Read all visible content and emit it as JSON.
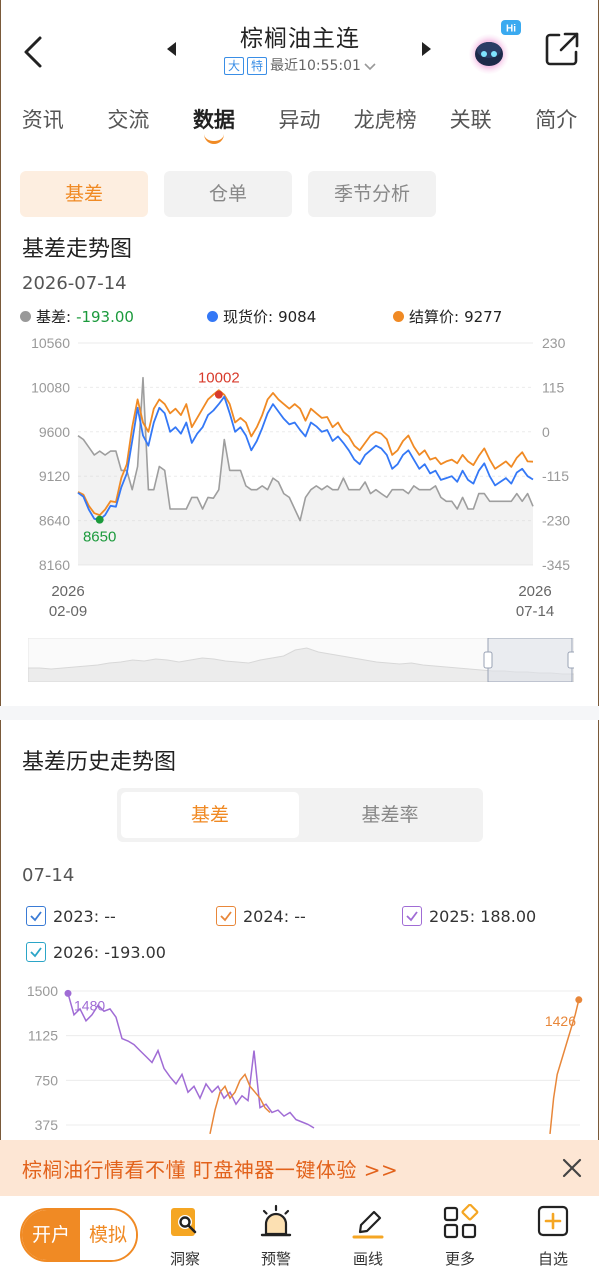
{
  "header": {
    "title": "棕榈油主连",
    "tag1": "大",
    "tag2": "特",
    "update_text": "最近10:55:01",
    "robot_badge": "Hi"
  },
  "tabs": [
    {
      "label": "资讯"
    },
    {
      "label": "交流"
    },
    {
      "label": "数据",
      "active": true
    },
    {
      "label": "异动"
    },
    {
      "label": "龙虎榜"
    },
    {
      "label": "关联"
    },
    {
      "label": "简介"
    }
  ],
  "subtabs": [
    {
      "label": "基差",
      "active": true
    },
    {
      "label": "仓单"
    },
    {
      "label": "季节分析"
    }
  ],
  "basis_trend": {
    "title": "基差走势图",
    "date": "2026-07-14",
    "legend": [
      {
        "label": "基差:",
        "value": "-193.00",
        "color": "#999999",
        "value_color": "#1b9a3c"
      },
      {
        "label": "现货价:",
        "value": "9084",
        "color": "#3478f6",
        "value_color": "#222222"
      },
      {
        "label": "结算价:",
        "value": "9277",
        "color": "#f08a24",
        "value_color": "#222222"
      }
    ],
    "colors": {
      "basis": "#9e9e9e",
      "spot": "#3478f6",
      "settle": "#f08a24"
    }
  },
  "chart_data": [
    {
      "type": "line",
      "title": "基差走势图",
      "x_start": "2026-02-09",
      "x_end": "2026-07-14",
      "x_tick_labels": [
        "2026\n02-09",
        "2026\n07-14"
      ],
      "y_left_ticks": [
        10560,
        10080,
        9600,
        9120,
        8640,
        8160
      ],
      "y_right_ticks": [
        230,
        115,
        0,
        -115,
        -230,
        -345
      ],
      "ylim_left": [
        8160,
        10560
      ],
      "ylim_right": [
        -345,
        230
      ],
      "annotations": [
        {
          "text": "10002",
          "value": 10002
        },
        {
          "text": "8650",
          "value": 8650
        }
      ],
      "series": [
        {
          "name": "现货价",
          "axis": "left",
          "values": [
            8940,
            8900,
            8760,
            8660,
            8650,
            8700,
            8800,
            8790,
            9000,
            9150,
            9500,
            9860,
            9560,
            9450,
            9700,
            9860,
            9800,
            9600,
            9650,
            9580,
            9700,
            9480,
            9580,
            9650,
            9780,
            9830,
            9900,
            9980,
            9800,
            9600,
            9650,
            9560,
            9400,
            9500,
            9640,
            9800,
            9900,
            9820,
            9740,
            9680,
            9700,
            9620,
            9550,
            9700,
            9660,
            9600,
            9620,
            9500,
            9550,
            9480,
            9400,
            9300,
            9250,
            9350,
            9400,
            9450,
            9420,
            9350,
            9200,
            9250,
            9350,
            9400,
            9300,
            9200,
            9250,
            9150,
            9180,
            9080,
            9100,
            9120,
            9060,
            9180,
            9080,
            9040,
            9180,
            9260,
            9120,
            9020,
            9060,
            9100,
            9040,
            9160,
            9200,
            9120,
            9084
          ]
        },
        {
          "name": "结算价",
          "axis": "left",
          "values": [
            8950,
            8920,
            8800,
            8720,
            8700,
            8760,
            8850,
            8840,
            9100,
            9250,
            9650,
            9950,
            9700,
            9600,
            9850,
            9950,
            9900,
            9800,
            9850,
            9780,
            9900,
            9650,
            9750,
            9850,
            9950,
            10002,
            10050,
            10000,
            9900,
            9700,
            9750,
            9700,
            9550,
            9650,
            9780,
            9950,
            10020,
            9950,
            9900,
            9850,
            9900,
            9850,
            9720,
            9850,
            9800,
            9750,
            9760,
            9650,
            9700,
            9600,
            9550,
            9450,
            9400,
            9480,
            9560,
            9600,
            9580,
            9520,
            9350,
            9400,
            9500,
            9560,
            9440,
            9350,
            9400,
            9300,
            9320,
            9250,
            9280,
            9300,
            9260,
            9350,
            9280,
            9240,
            9340,
            9420,
            9300,
            9200,
            9240,
            9280,
            9220,
            9320,
            9380,
            9280,
            9277
          ]
        },
        {
          "name": "基差",
          "axis": "right",
          "values": [
            -10,
            -20,
            -40,
            -60,
            -50,
            -60,
            -50,
            -50,
            -100,
            -100,
            -150,
            -90,
            140,
            -150,
            -150,
            -90,
            -100,
            -200,
            -200,
            -200,
            -200,
            -170,
            -170,
            -200,
            -170,
            -172,
            -150,
            -20,
            -100,
            -100,
            -100,
            -140,
            -150,
            -150,
            -140,
            -150,
            -120,
            -130,
            -160,
            -170,
            -200,
            -230,
            -170,
            -150,
            -140,
            -150,
            -140,
            -150,
            -150,
            -120,
            -150,
            -150,
            -150,
            -130,
            -160,
            -150,
            -160,
            -170,
            -150,
            -150,
            -150,
            -160,
            -140,
            -150,
            -150,
            -150,
            -140,
            -170,
            -180,
            -180,
            -200,
            -170,
            -200,
            -200,
            -160,
            -160,
            -180,
            -180,
            -180,
            -180,
            -180,
            -160,
            -180,
            -160,
            -193
          ]
        }
      ]
    },
    {
      "type": "line",
      "title": "基差历史走势图",
      "date": "07-14",
      "y_ticks": [
        1500,
        1125,
        750,
        375
      ],
      "annotations": [
        {
          "text": "1480"
        },
        {
          "text": "1426"
        }
      ],
      "series": [
        {
          "name": "2023",
          "value_label": "--",
          "color": "#3a7bd5",
          "values": []
        },
        {
          "name": "2024",
          "value_label": "--",
          "color": "#e8873a",
          "values": []
        },
        {
          "name": "2025",
          "value_label": "188.00",
          "color": "#a06cd5",
          "values": [
            1480,
            1300,
            1350,
            1250,
            1300,
            1380,
            1330,
            1350,
            1280,
            1100,
            1080,
            1050,
            1000,
            950,
            900,
            1000,
            850,
            780,
            720,
            800,
            650,
            700,
            600,
            720,
            650,
            700,
            600,
            650,
            550,
            620,
            580,
            1000,
            520,
            550,
            480,
            500,
            450,
            480,
            420,
            400,
            380,
            350
          ]
        },
        {
          "name": "2026",
          "value_label": "-193.00",
          "color": "#2ba5c7",
          "values": []
        },
        {
          "name": "2024 tail",
          "color": "#e8873a",
          "values": [
            300,
            600,
            800,
            900,
            1000,
            1100,
            1200,
            1300,
            1426
          ]
        }
      ]
    }
  ],
  "basis_history": {
    "title": "基差历史走势图",
    "seg": [
      {
        "label": "基差",
        "active": true
      },
      {
        "label": "基差率"
      }
    ],
    "date": "07-14",
    "checkboxes": [
      {
        "label": "2023: --",
        "color": "#3a7bd5"
      },
      {
        "label": "2024: --",
        "color": "#e8873a"
      },
      {
        "label": "2025: 188.00",
        "color": "#a06cd5"
      },
      {
        "label": "2026: -193.00",
        "color": "#2ba5c7"
      }
    ]
  },
  "banner": {
    "text": "棕榈油行情看不懂  盯盘神器一键体验 >>"
  },
  "bottom": {
    "pill_open": "开户",
    "pill_sim": "模拟",
    "items": [
      {
        "label": "洞察",
        "icon": "insight-icon"
      },
      {
        "label": "预警",
        "icon": "alarm-icon"
      },
      {
        "label": "画线",
        "icon": "pen-icon"
      },
      {
        "label": "更多",
        "icon": "grid-icon"
      },
      {
        "label": "自选",
        "icon": "plus-icon"
      }
    ]
  }
}
